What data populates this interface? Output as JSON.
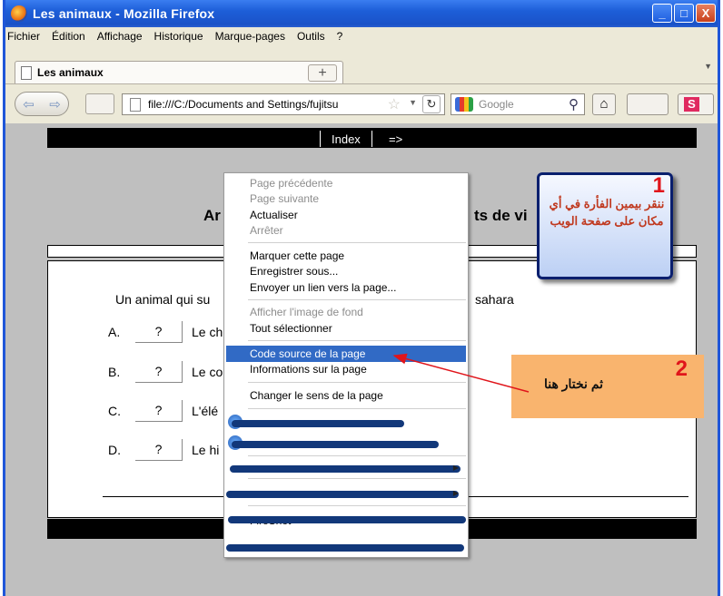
{
  "window": {
    "title": "Les animaux - Mozilla Firefox",
    "controls": [
      "_",
      "□",
      "X"
    ]
  },
  "menubar": [
    "Fichier",
    "Édition",
    "Affichage",
    "Historique",
    "Marque-pages",
    "Outils",
    "?"
  ],
  "tab": {
    "label": "Les animaux",
    "new_tab": "+"
  },
  "nav": {
    "url": "file:///C:/Documents and Settings/fujitsu",
    "search_placeholder": "Google",
    "s_label": "S"
  },
  "page": {
    "index_link": "Index",
    "next_link": "=>",
    "title_left": "Ar",
    "title_right": "ts de vi",
    "question_left": "Un animal qui su",
    "question_right": "sahara",
    "answers": [
      {
        "letter": "A.",
        "btn": "?",
        "text": "Le ch"
      },
      {
        "letter": "B.",
        "btn": "?",
        "text": "Le co"
      },
      {
        "letter": "C.",
        "btn": "?",
        "text": "L'élé"
      },
      {
        "letter": "D.",
        "btn": "?",
        "text": "Le hi"
      }
    ]
  },
  "context_menu": {
    "back": "Page précédente",
    "forward": "Page suivante",
    "reload": "Actualiser",
    "stop": "Arrêter",
    "bookmark": "Marquer cette page",
    "save_as": "Enregistrer sous...",
    "send_link": "Envoyer un lien vers la page...",
    "view_bg": "Afficher l'image de fond",
    "select_all": "Tout sélectionner",
    "view_source": "Code source de la page",
    "page_info": "Informations sur la page",
    "switch_dir": "Changer le sens de la page",
    "fireshot": "FireShot"
  },
  "callouts": {
    "step1_number": "1",
    "step1_text": "ننقر بيمين الفأرة في أي مكان على صفحة الويب",
    "step2_number": "2",
    "step2_text": "ثم نختار هنا"
  },
  "colors": {
    "title_bar": "#1d5ed8",
    "menu_highlight": "#316ac5",
    "callout2_bg": "#f9b46e",
    "arrow": "#e0151b"
  }
}
